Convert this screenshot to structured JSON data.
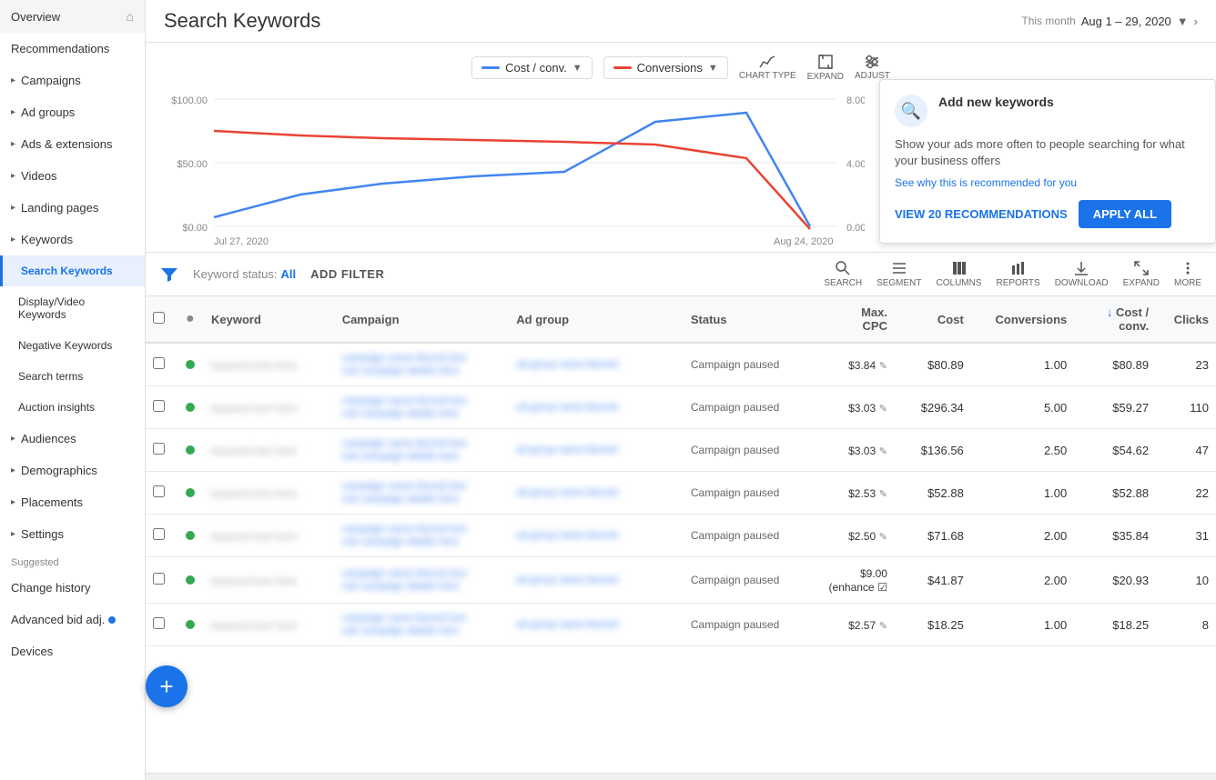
{
  "sidebar": {
    "items": [
      {
        "id": "overview",
        "label": "Overview",
        "hasHome": true,
        "indent": 0,
        "active": false
      },
      {
        "id": "recommendations",
        "label": "Recommendations",
        "indent": 0,
        "active": false
      },
      {
        "id": "campaigns",
        "label": "Campaigns",
        "hasArrow": true,
        "indent": 0,
        "active": false
      },
      {
        "id": "ad-groups",
        "label": "Ad groups",
        "hasArrow": true,
        "indent": 0,
        "active": false
      },
      {
        "id": "ads-extensions",
        "label": "Ads & extensions",
        "hasArrow": true,
        "indent": 0,
        "active": false
      },
      {
        "id": "videos",
        "label": "Videos",
        "hasArrow": true,
        "indent": 0,
        "active": false
      },
      {
        "id": "landing-pages",
        "label": "Landing pages",
        "hasArrow": true,
        "indent": 0,
        "active": false
      },
      {
        "id": "keywords",
        "label": "Keywords",
        "hasArrow": true,
        "indent": 0,
        "active": false
      },
      {
        "id": "search-keywords",
        "label": "Search Keywords",
        "indent": 1,
        "active": true
      },
      {
        "id": "display-video-keywords",
        "label": "Display/Video Keywords",
        "indent": 1,
        "active": false
      },
      {
        "id": "negative-keywords",
        "label": "Negative Keywords",
        "indent": 1,
        "active": false
      },
      {
        "id": "search-terms",
        "label": "Search terms",
        "indent": 1,
        "active": false
      },
      {
        "id": "auction-insights",
        "label": "Auction insights",
        "indent": 1,
        "active": false
      },
      {
        "id": "audiences",
        "label": "Audiences",
        "hasArrow": true,
        "indent": 0,
        "active": false
      },
      {
        "id": "demographics",
        "label": "Demographics",
        "hasArrow": true,
        "indent": 0,
        "active": false
      },
      {
        "id": "placements",
        "label": "Placements",
        "hasArrow": true,
        "indent": 0,
        "active": false
      },
      {
        "id": "settings",
        "label": "Settings",
        "hasArrow": true,
        "indent": 0,
        "active": false
      }
    ],
    "suggested_label": "Suggested",
    "suggested_items": [
      {
        "id": "change-history",
        "label": "Change history"
      },
      {
        "id": "advanced-bid",
        "label": "Advanced bid adj.",
        "hasDot": true
      },
      {
        "id": "devices",
        "label": "Devices"
      }
    ]
  },
  "header": {
    "title": "Search Keywords",
    "date_label": "This month",
    "date_range": "Aug 1 – 29, 2020"
  },
  "chart": {
    "metric1_label": "Cost / conv.",
    "metric2_label": "Conversions",
    "chart_type_label": "CHART TYPE",
    "expand_label": "EXPAND",
    "adjust_label": "ADJUST",
    "y_axis_left": [
      "$100.00",
      "$50.00",
      "$0.00"
    ],
    "y_axis_right": [
      "8.00",
      "4.00",
      "0.00"
    ],
    "x_axis": [
      "Jul 27, 2020",
      "Aug 24, 2020"
    ]
  },
  "recommendation": {
    "title": "Add new keywords",
    "description": "Show your ads more often to people searching for what your business offers",
    "link_text": "See why this is recommended for you",
    "view_btn": "VIEW 20 RECOMMENDATIONS",
    "apply_btn": "APPLY ALL"
  },
  "filter": {
    "status_label": "Keyword status:",
    "status_value": "All",
    "add_filter_label": "ADD FILTER",
    "icons": [
      "search",
      "segment",
      "columns",
      "reports",
      "download",
      "expand",
      "more"
    ],
    "icon_labels": [
      "SEARCH",
      "SEGMENT",
      "COLUMNS",
      "REPORTS",
      "DOWNLOAD",
      "EXPAND",
      "MORE"
    ]
  },
  "table": {
    "columns": [
      {
        "id": "select",
        "label": ""
      },
      {
        "id": "dot",
        "label": ""
      },
      {
        "id": "keyword",
        "label": "Keyword"
      },
      {
        "id": "campaign",
        "label": "Campaign"
      },
      {
        "id": "adgroup",
        "label": "Ad group"
      },
      {
        "id": "status",
        "label": "Status"
      },
      {
        "id": "maxcpc",
        "label": "Max. CPC"
      },
      {
        "id": "cost",
        "label": "Cost"
      },
      {
        "id": "conversions",
        "label": "Conversions"
      },
      {
        "id": "costconv",
        "label": "Cost / conv."
      },
      {
        "id": "clicks",
        "label": "Clicks"
      }
    ],
    "rows": [
      {
        "keyword": "blurred1",
        "campaign": "blurred",
        "adgroup": "blurred",
        "status": "Campaign paused",
        "maxcpc": "$3.84",
        "cost": "$80.89",
        "conversions": "1.00",
        "costconv": "$80.89",
        "clicks": "23"
      },
      {
        "keyword": "blurred2",
        "campaign": "blurred",
        "adgroup": "blurred",
        "status": "Campaign paused",
        "maxcpc": "$3.03",
        "cost": "$296.34",
        "conversions": "5.00",
        "costconv": "$59.27",
        "clicks": "110"
      },
      {
        "keyword": "blurred3",
        "campaign": "blurred",
        "adgroup": "blurred",
        "status": "Campaign paused",
        "maxcpc": "$3.03",
        "cost": "$136.56",
        "conversions": "2.50",
        "costconv": "$54.62",
        "clicks": "47"
      },
      {
        "keyword": "blurred4",
        "campaign": "blurred",
        "adgroup": "blurred",
        "status": "Campaign paused",
        "maxcpc": "$2.53",
        "cost": "$52.88",
        "conversions": "1.00",
        "costconv": "$52.88",
        "clicks": "22"
      },
      {
        "keyword": "blurred5",
        "campaign": "blurred",
        "adgroup": "blurred",
        "status": "Campaign paused",
        "maxcpc": "$2.50",
        "cost": "$71.68",
        "conversions": "2.00",
        "costconv": "$35.84",
        "clicks": "31"
      },
      {
        "keyword": "blurred6",
        "campaign": "blurred",
        "adgroup": "blurred",
        "status": "Campaign paused",
        "maxcpc": "$9.00 (enhance",
        "cost": "$41.87",
        "conversions": "2.00",
        "costconv": "$20.93",
        "clicks": "10",
        "enhanced": true
      },
      {
        "keyword": "blurred7",
        "campaign": "blurred",
        "adgroup": "blurred",
        "status": "Campaign paused",
        "maxcpc": "$2.57",
        "cost": "$18.25",
        "conversions": "1.00",
        "costconv": "$18.25",
        "clicks": "8"
      }
    ]
  },
  "colors": {
    "blue": "#1a73e8",
    "red": "#ea4335",
    "sidebar_active_bg": "#e8f0fe",
    "green": "#34a853"
  }
}
